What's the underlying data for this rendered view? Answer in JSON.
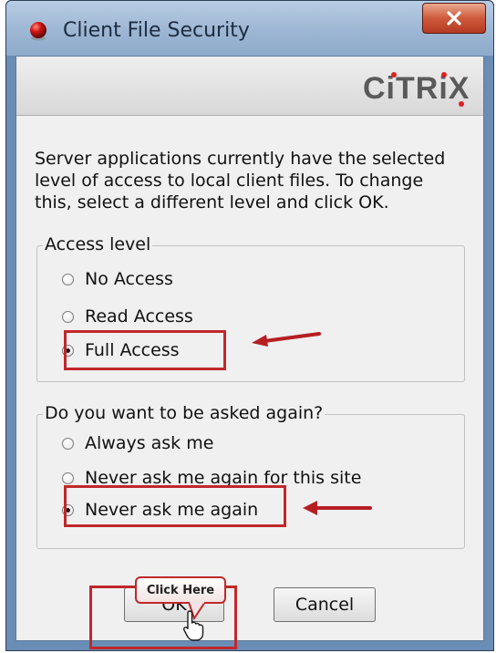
{
  "window": {
    "title": "Client File Security",
    "close_glyph": "X"
  },
  "banner": {
    "logo_text": "CiTRiX",
    "logo_dot_color": "#e02020"
  },
  "description": "Server applications currently have the selected level of access to local client files. To change this, select a different level and click OK.",
  "access_level": {
    "legend": "Access level",
    "options": [
      {
        "label": "No Access",
        "checked": false
      },
      {
        "label": "Read Access",
        "checked": false
      },
      {
        "label": "Full Access",
        "checked": true
      }
    ]
  },
  "ask_again": {
    "legend": "Do you want to be asked again?",
    "options": [
      {
        "label": "Always ask me",
        "checked": false
      },
      {
        "label": "Never ask me again for this site",
        "checked": false
      },
      {
        "label": "Never ask me again",
        "checked": true
      }
    ]
  },
  "buttons": {
    "ok_label": "OK",
    "cancel_label": "Cancel"
  },
  "annotation": {
    "callout_text": "Click Here",
    "highlight_color": "#c0282b"
  },
  "icons": {
    "app": "red-sphere-icon",
    "close": "close-icon",
    "cursor": "hand-pointer-icon",
    "arrow": "red-arrow-icon"
  }
}
